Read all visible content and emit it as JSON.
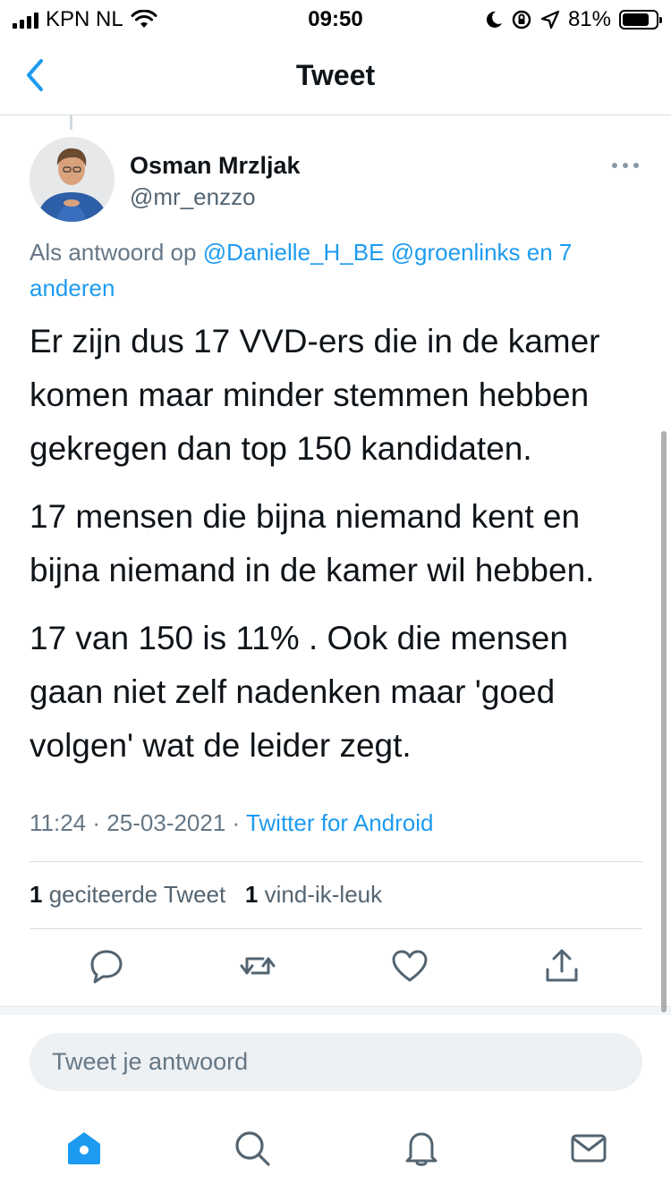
{
  "status_bar": {
    "carrier": "KPN NL",
    "time": "09:50",
    "battery": "81%",
    "battery_level": 0.81
  },
  "nav": {
    "title": "Tweet",
    "back_icon": "chevron-left-icon"
  },
  "tweet": {
    "author_name": "Osman Mrzljak",
    "author_handle": "@mr_enzzo",
    "reply_prefix": "Als antwoord op",
    "reply_mention_1": "@Danielle_H_BE",
    "reply_mention_2": "@groenlinks",
    "reply_others": "en 7 anderen",
    "paragraphs": [
      "Er zijn dus 17 VVD-ers die in de kamer komen maar minder stemmen hebben gekregen dan top 150 kandidaten.",
      "17 mensen die bijna niemand kent en bijna niemand in de kamer wil hebben.",
      "17 van 150 is 11% . Ook die mensen gaan niet zelf nadenken maar 'goed volgen' wat de leider zegt."
    ],
    "time": "11:24",
    "date": "25-03-2021",
    "source": "Twitter for Android",
    "separator": "·"
  },
  "stats": {
    "quote_count": "1",
    "quote_label": "geciteerde Tweet",
    "like_count": "1",
    "like_label": "vind-ik-leuk"
  },
  "actions": [
    "reply-icon",
    "retweet-icon",
    "like-icon",
    "share-icon"
  ],
  "reply_box": {
    "placeholder": "Tweet je antwoord"
  },
  "tab_bar": [
    "home-icon",
    "search-icon",
    "notifications-icon",
    "messages-icon"
  ],
  "colors": {
    "accent": "#1d9bf0",
    "text": "#0f1419",
    "muted": "#657786"
  }
}
